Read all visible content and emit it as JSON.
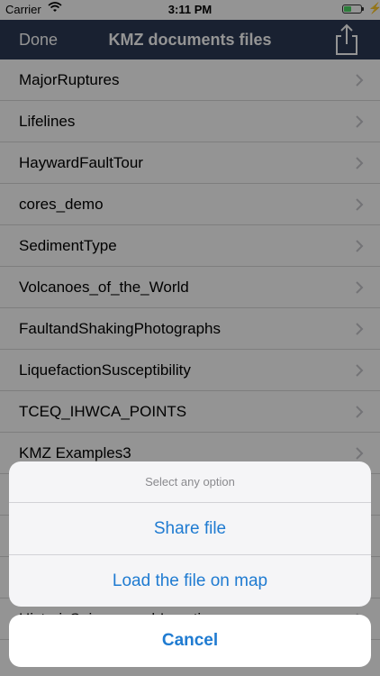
{
  "status": {
    "carrier": "Carrier",
    "time": "3:11 PM",
    "battery_level": 0.45
  },
  "nav": {
    "done_label": "Done",
    "title": "KMZ documents files",
    "share_icon": "share-icon"
  },
  "files": [
    "MajorRuptures",
    "Lifelines",
    "HaywardFaultTour",
    "cores_demo",
    "SedimentType",
    "Volcanoes_of_the_World",
    "FaultandShakingPhotographs",
    "LiquefactionSusceptibility",
    "TCEQ_IHWCA_POINTS",
    "KMZ Examples3",
    "",
    "",
    "",
    "HistoricSeismographLocations"
  ],
  "sheet": {
    "header": "Select any option",
    "actions": [
      "Share file",
      "Load the file on map"
    ],
    "cancel": "Cancel"
  },
  "colors": {
    "nav_bg": "#2b3a55",
    "accent": "#1f7bd1",
    "battery": "#4cd964"
  }
}
